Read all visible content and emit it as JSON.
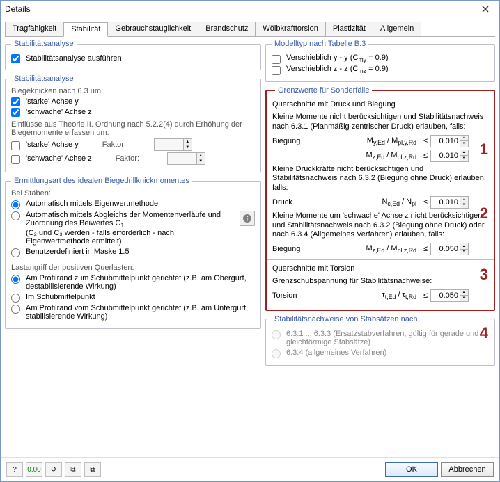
{
  "window": {
    "title": "Details"
  },
  "tabs": {
    "items": [
      "Tragfähigkeit",
      "Stabilität",
      "Gebrauchstauglichkeit",
      "Brandschutz",
      "Wölbkrafttorsion",
      "Plastizität",
      "Allgemein"
    ],
    "active_index": 1
  },
  "left": {
    "stab_analyse": {
      "legend": "Stabilitätsanalyse",
      "do_analysis": "Stabilitätsanalyse ausführen",
      "biege_hdr": "Biegeknicken nach 6.3 um:",
      "chk_y": "'starke' Achse y",
      "chk_z": "'schwache' Achse z",
      "einfl_hdr": "Einflüsse aus Theorie II. Ordnung nach 5.2.2(4) durch Erhöhung der Biegemomente erfassen um:",
      "chk_y2": "'starke' Achse y",
      "chk_z2": "'schwache' Achse z",
      "faktor_label": "Faktor:"
    },
    "ermittlung": {
      "legend": "Ermittlungsart des idealen Biegedrillknickmomentes",
      "bei_staeben": "Bei Stäben:",
      "opt_auto_eigen": "Automatisch mittels Eigenwertmethode",
      "opt_auto_abgleich": "Automatisch mittels Abgleichs der Momentenverläufe und Zuordnung des Beiwertes C",
      "opt_auto_abgleich_sub": "(C₂ und C₃ werden - falls erforderlich - nach Eigenwertmethode ermittelt)",
      "opt_userdef": "Benutzerdefiniert in Maske 1.5",
      "lastangriff_hdr": "Lastangriff der positiven Querlasten:",
      "opt_profil_zum": "Am Profilrand zum Schubmittelpunkt gerichtet (z.B. am Obergurt, destabilisierende Wirkung)",
      "opt_schubmittel": "Im Schubmittelpunkt",
      "opt_profil_vom": "Am Profilrand vom Schubmittelpunkt gerichtet (z.B. am Untergurt, stabilisierende Wirkung)"
    }
  },
  "right": {
    "modelltyp": {
      "legend": "Modelltyp nach Tabelle B.3",
      "chk_y": "Verschieblich y - y (C",
      "chk_y_suffix": " = 0.9)",
      "chk_z": "Verschieblich z - z (C",
      "chk_z_suffix": " = 0.9)"
    },
    "grenz": {
      "legend": "Grenzwerte für Sonderfälle",
      "qs_druck_biegung": "Querschnitte mit Druck und Biegung",
      "p1": "Kleine Momente nicht berücksichtigen und Stabilitätsnachweis nach 6.3.1 (Planmäßig zentrischer Druck) erlauben, falls:",
      "biegung": "Biegung",
      "druck": "Druck",
      "torsion": "Torsion",
      "p2": "Kleine Druckkräfte nicht berücksichtigen und Stabilitätsnachweis nach 6.3.2 (Biegung ohne Druck) erlauben, falls:",
      "p3": "Kleine Momente um 'schwache' Achse z nicht berücksichtigen und Stabilitätsnachweis nach 6.3.2 (Biegung ohne Druck) oder nach 6.3.4 (Allgemeines Verfahren) erlauben, falls:",
      "qs_torsion": "Querschnitte mit Torsion",
      "p4": "Grenzschubspannung für Stabilitätsnachweise:",
      "vals": {
        "myEd": "0.010",
        "mzEd": "0.010",
        "ncEd": "0.010",
        "mzEd2": "0.050",
        "tors": "0.050"
      },
      "formulas": {
        "r1a": "M<sub>y,Ed</sub> / M<sub>pl,y,Rd</sub>",
        "r1b": "M<sub>z,Ed</sub> / M<sub>pl,z,Rd</sub>",
        "r2": "N<sub>c,Ed</sub> / N<sub>pl</sub>",
        "r3": "M<sub>z,Ed</sub> / M<sub>pl,z,Rd</sub>",
        "r4": "τ<sub>t,Ed</sub> / τ<sub>t,Rd</sub>"
      },
      "markers": {
        "m1": "1",
        "m2": "2",
        "m3": "3",
        "m4": "4"
      }
    },
    "stabsatz": {
      "legend": "Stabilitätsnachweise von Stabsätzen nach",
      "opt1": "6.3.1 ... 6.3.3  (Ersatzstabverfahren, gültig für gerade und gleichförmige Stabsätze)",
      "opt2": "6.3.4 (allgemeines Verfahren)"
    }
  },
  "footer": {
    "ok": "OK",
    "cancel": "Abbrechen"
  }
}
